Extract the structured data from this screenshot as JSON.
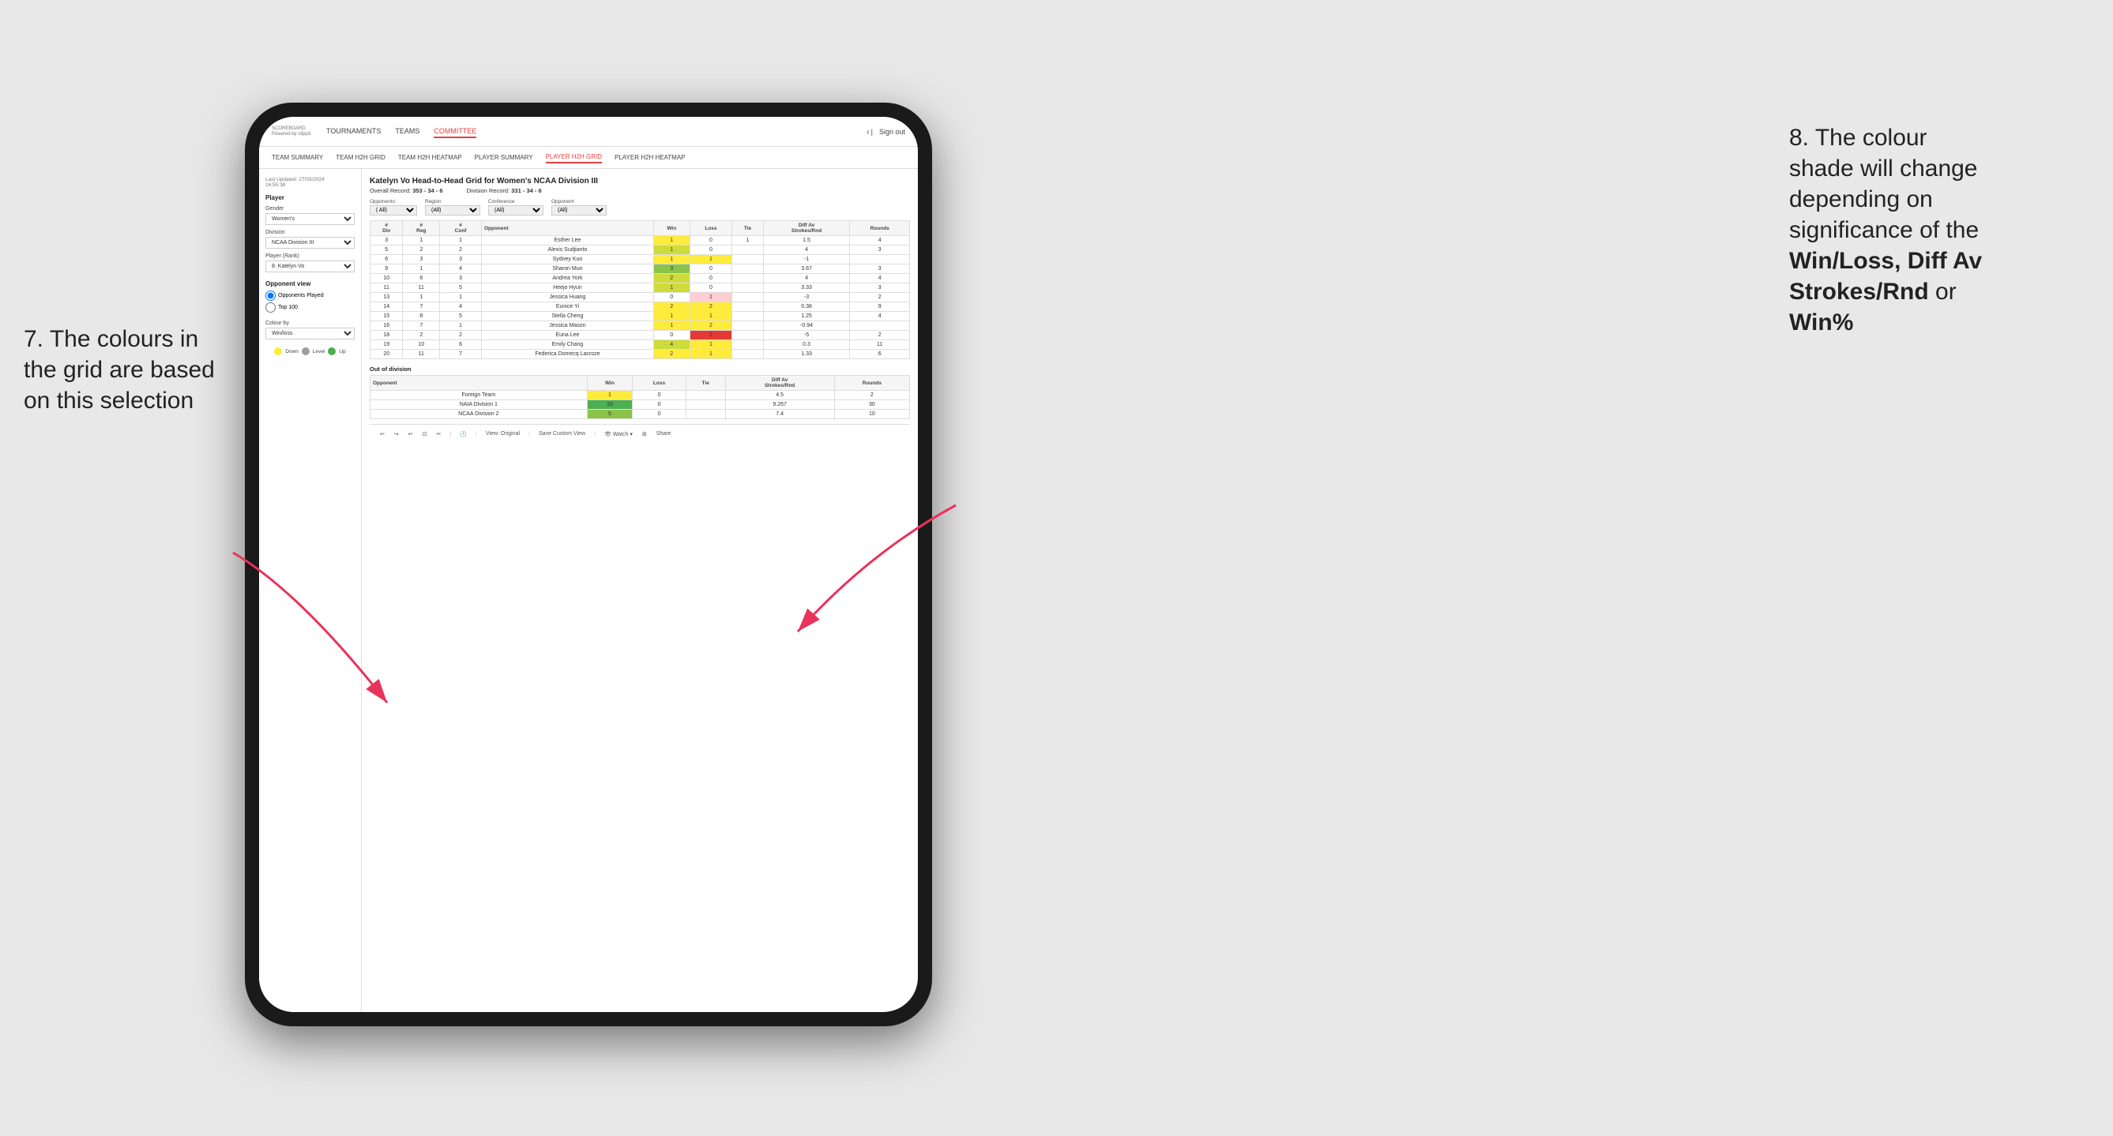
{
  "annotation": {
    "left_line1": "7. The colours in",
    "left_line2": "the grid are based",
    "left_line3": "on this selection",
    "right_line1": "8. The colour",
    "right_line2": "shade will change",
    "right_line3": "depending on",
    "right_line4": "significance of the",
    "right_bold1": "Win/Loss, Diff Av",
    "right_bold2": "Strokes/Rnd",
    "right_suffix": " or",
    "right_bold3": "Win%"
  },
  "nav": {
    "logo_main": "SCOREBOARD",
    "logo_sub": "Powered by clippd",
    "links": [
      "TOURNAMENTS",
      "TEAMS",
      "COMMITTEE"
    ],
    "active_link": "COMMITTEE",
    "sign_out": "Sign out"
  },
  "sub_nav": {
    "links": [
      "TEAM SUMMARY",
      "TEAM H2H GRID",
      "TEAM H2H HEATMAP",
      "PLAYER SUMMARY",
      "PLAYER H2H GRID",
      "PLAYER H2H HEATMAP"
    ],
    "active": "PLAYER H2H GRID"
  },
  "left_panel": {
    "last_updated_label": "Last Updated: 27/03/2024",
    "last_updated_time": "16:55:38",
    "player_section": "Player",
    "gender_label": "Gender",
    "gender_value": "Women's",
    "division_label": "Division",
    "division_value": "NCAA Division III",
    "player_rank_label": "Player (Rank)",
    "player_rank_value": "8. Katelyn Vo",
    "opponent_view_label": "Opponent view",
    "radio_opponents": "Opponents Played",
    "radio_top100": "Top 100",
    "colour_by_label": "Colour by",
    "colour_by_value": "Win/loss",
    "legend_down": "Down",
    "legend_level": "Level",
    "legend_up": "Up"
  },
  "grid": {
    "title": "Katelyn Vo Head-to-Head Grid for Women's NCAA Division III",
    "overall_record_label": "Overall Record:",
    "overall_record_value": "353 - 34 - 6",
    "division_record_label": "Division Record:",
    "division_record_value": "331 - 34 - 6",
    "opponents_label": "Opponents:",
    "opponents_value": "(All)",
    "region_label": "Region",
    "region_value": "(All)",
    "conference_label": "Conference",
    "conference_value": "(All)",
    "opponent_label": "Opponent",
    "opponent_value": "(All)",
    "col_headers": [
      "#\nDiv",
      "#\nReg",
      "#\nConf",
      "Opponent",
      "Win",
      "Loss",
      "Tie",
      "Diff Av\nStrokes/Rnd",
      "Rounds"
    ],
    "rows": [
      {
        "div": "3",
        "reg": "1",
        "conf": "1",
        "opponent": "Esther Lee",
        "win": 1,
        "loss": 0,
        "tie": 1,
        "diff": 1.5,
        "rounds": 4,
        "win_color": "yellow",
        "loss_color": "empty",
        "tie_color": "empty"
      },
      {
        "div": "5",
        "reg": "2",
        "conf": "2",
        "opponent": "Alexis Sudjianto",
        "win": 1,
        "loss": 0,
        "tie": 0,
        "diff": 4.0,
        "rounds": 3,
        "win_color": "green_light",
        "loss_color": "empty",
        "tie_color": "empty"
      },
      {
        "div": "6",
        "reg": "3",
        "conf": "3",
        "opponent": "Sydney Kuo",
        "win": 1,
        "loss": 1,
        "tie": 0,
        "diff": -1.0,
        "rounds": "",
        "win_color": "yellow",
        "loss_color": "yellow",
        "tie_color": "empty"
      },
      {
        "div": "9",
        "reg": "1",
        "conf": "4",
        "opponent": "Sharon Mun",
        "win": 3,
        "loss": 0,
        "tie": 0,
        "diff": 3.67,
        "rounds": 3,
        "win_color": "green_med",
        "loss_color": "empty",
        "tie_color": "empty"
      },
      {
        "div": "10",
        "reg": "6",
        "conf": "3",
        "opponent": "Andrea York",
        "win": 2,
        "loss": 0,
        "tie": 0,
        "diff": 4.0,
        "rounds": 4,
        "win_color": "green_light",
        "loss_color": "empty",
        "tie_color": "empty"
      },
      {
        "div": "11",
        "reg": "11",
        "conf": "5",
        "opponent": "Heejo Hyun",
        "win": 1,
        "loss": 0,
        "tie": 0,
        "diff": 3.33,
        "rounds": 3,
        "win_color": "green_light",
        "loss_color": "empty",
        "tie_color": "empty"
      },
      {
        "div": "13",
        "reg": "1",
        "conf": "1",
        "opponent": "Jessica Huang",
        "win": 0,
        "loss": 1,
        "tie": 0,
        "diff": -3.0,
        "rounds": 2,
        "win_color": "empty",
        "loss_color": "red_light",
        "tie_color": "empty"
      },
      {
        "div": "14",
        "reg": "7",
        "conf": "4",
        "opponent": "Eunice Yi",
        "win": 2,
        "loss": 2,
        "tie": 0,
        "diff": 0.38,
        "rounds": 9,
        "win_color": "yellow",
        "loss_color": "yellow",
        "tie_color": "empty"
      },
      {
        "div": "15",
        "reg": "8",
        "conf": "5",
        "opponent": "Stella Cheng",
        "win": 1,
        "loss": 1,
        "tie": 0,
        "diff": 1.25,
        "rounds": 4,
        "win_color": "yellow",
        "loss_color": "yellow",
        "tie_color": "empty"
      },
      {
        "div": "16",
        "reg": "7",
        "conf": "1",
        "opponent": "Jessica Mason",
        "win": 1,
        "loss": 2,
        "tie": 0,
        "diff": -0.94,
        "rounds": "",
        "win_color": "yellow",
        "loss_color": "yellow",
        "tie_color": "empty"
      },
      {
        "div": "18",
        "reg": "2",
        "conf": "2",
        "opponent": "Euna Lee",
        "win": 0,
        "loss": 2,
        "tie": 0,
        "diff": -5.0,
        "rounds": 2,
        "win_color": "empty",
        "loss_color": "red_dark",
        "tie_color": "empty"
      },
      {
        "div": "19",
        "reg": "10",
        "conf": "6",
        "opponent": "Emily Chang",
        "win": 4,
        "loss": 1,
        "tie": 0,
        "diff": 0.3,
        "rounds": 11,
        "win_color": "green_light",
        "loss_color": "yellow",
        "tie_color": "empty"
      },
      {
        "div": "20",
        "reg": "11",
        "conf": "7",
        "opponent": "Federica Domecq Lacroze",
        "win": 2,
        "loss": 1,
        "tie": 0,
        "diff": 1.33,
        "rounds": 6,
        "win_color": "yellow",
        "loss_color": "yellow",
        "tie_color": "empty"
      }
    ],
    "out_of_division_title": "Out of division",
    "out_of_division_rows": [
      {
        "opponent": "Foreign Team",
        "win": 1,
        "loss": 0,
        "tie": 0,
        "diff": 4.5,
        "rounds": 2,
        "win_color": "yellow",
        "loss_color": "empty"
      },
      {
        "opponent": "NAIA Division 1",
        "win": 15,
        "loss": 0,
        "tie": 0,
        "diff": 9.267,
        "rounds": 30,
        "win_color": "green_dark",
        "loss_color": "empty"
      },
      {
        "opponent": "NCAA Division 2",
        "win": 5,
        "loss": 0,
        "tie": 0,
        "diff": 7.4,
        "rounds": 10,
        "win_color": "green_med",
        "loss_color": "empty"
      }
    ]
  },
  "toolbar": {
    "view_original": "View: Original",
    "save_custom": "Save Custom View",
    "watch": "Watch",
    "share": "Share"
  }
}
